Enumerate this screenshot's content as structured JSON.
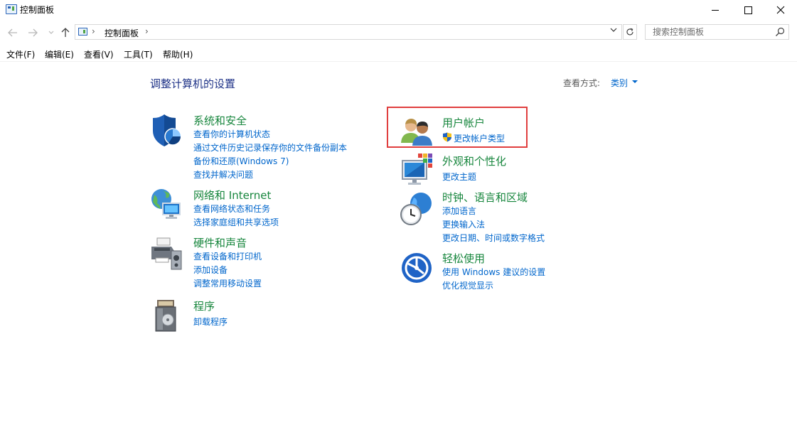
{
  "window": {
    "title": "控制面板"
  },
  "address_bar": {
    "path": "控制面板",
    "separator": "›"
  },
  "search": {
    "placeholder": "搜索控制面板"
  },
  "menu": [
    "文件(F)",
    "编辑(E)",
    "查看(V)",
    "工具(T)",
    "帮助(H)"
  ],
  "content": {
    "title": "调整计算机的设置",
    "view_by_label": "查看方式:",
    "view_by_value": "类别"
  },
  "categories": [
    {
      "title": "系统和安全",
      "icon": "shield-icon",
      "links": [
        "查看你的计算机状态",
        "通过文件历史记录保存你的文件备份副本",
        "备份和还原(Windows 7)",
        "查找并解决问题"
      ]
    },
    {
      "title": "网络和 Internet",
      "icon": "network-icon",
      "links": [
        "查看网络状态和任务",
        "选择家庭组和共享选项"
      ]
    },
    {
      "title": "硬件和声音",
      "icon": "printer-icon",
      "links": [
        "查看设备和打印机",
        "添加设备",
        "调整常用移动设置"
      ]
    },
    {
      "title": "程序",
      "icon": "programs-icon",
      "links": [
        "卸载程序"
      ]
    },
    {
      "title": "用户帐户",
      "icon": "users-icon",
      "links": [
        "更改帐户类型"
      ]
    },
    {
      "title": "外观和个性化",
      "icon": "appearance-icon",
      "links": [
        "更改主题"
      ]
    },
    {
      "title": "时钟、语言和区域",
      "icon": "clock-globe-icon",
      "links": [
        "添加语言",
        "更换输入法",
        "更改日期、时间或数字格式"
      ]
    },
    {
      "title": "轻松使用",
      "icon": "ease-of-access-icon",
      "links": [
        "使用 Windows 建议的设置",
        "优化视觉显示"
      ]
    }
  ],
  "colors": {
    "category_title": "#17863d",
    "link": "#0066cc",
    "page_title": "#1e3287",
    "highlight": "#e03e3e"
  }
}
